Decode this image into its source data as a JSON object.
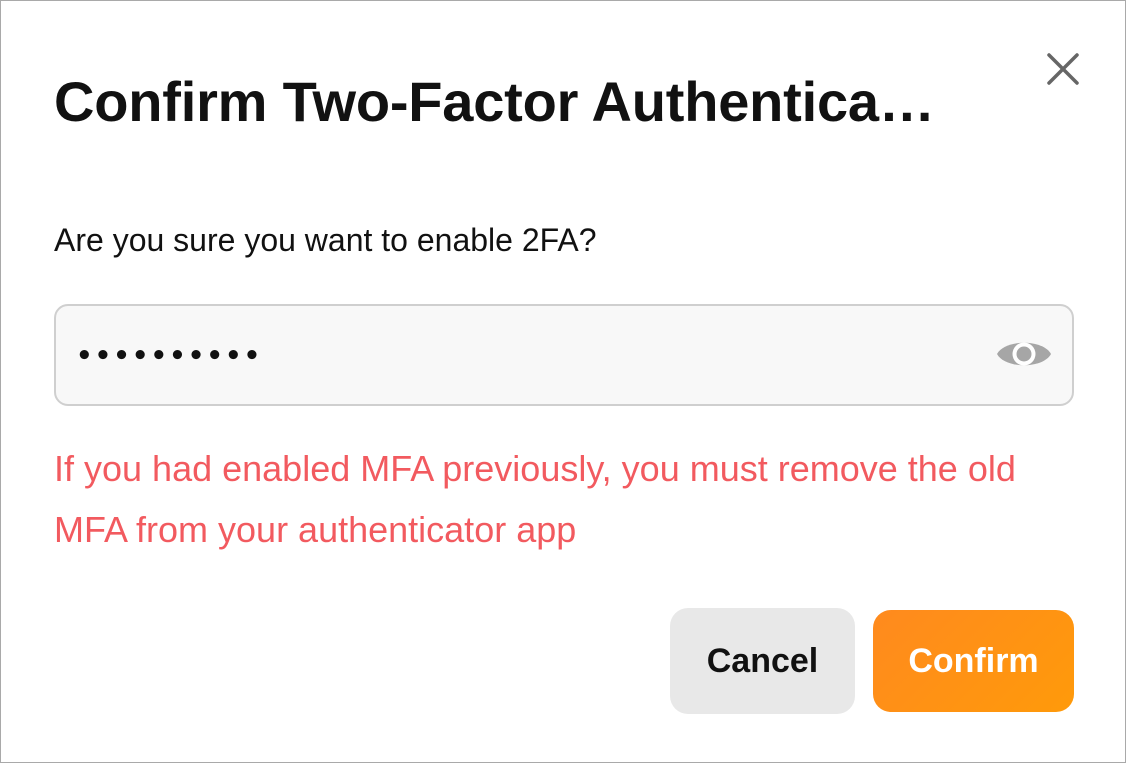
{
  "dialog": {
    "title": "Confirm Two-Factor Authentica…",
    "close_icon": "close-icon",
    "subtitle": "Are you sure you want to enable 2FA?",
    "password": {
      "value": "••••••••••",
      "toggle_icon": "eye-icon"
    },
    "warning": "If you had enabled MFA previously, you must remove the old MFA from your authenticator app",
    "buttons": {
      "cancel_label": "Cancel",
      "confirm_label": "Confirm"
    }
  },
  "colors": {
    "title_text": "#111111",
    "warning_text": "#f25a5f",
    "confirm_bg_start": "#ff8a1e",
    "confirm_bg_end": "#ff9a0a",
    "cancel_bg": "#e8e8e8",
    "field_bg": "#f8f8f8",
    "field_border": "#cfcfcf",
    "icon_gray": "#a6a6a6",
    "close_icon": "#666666"
  }
}
